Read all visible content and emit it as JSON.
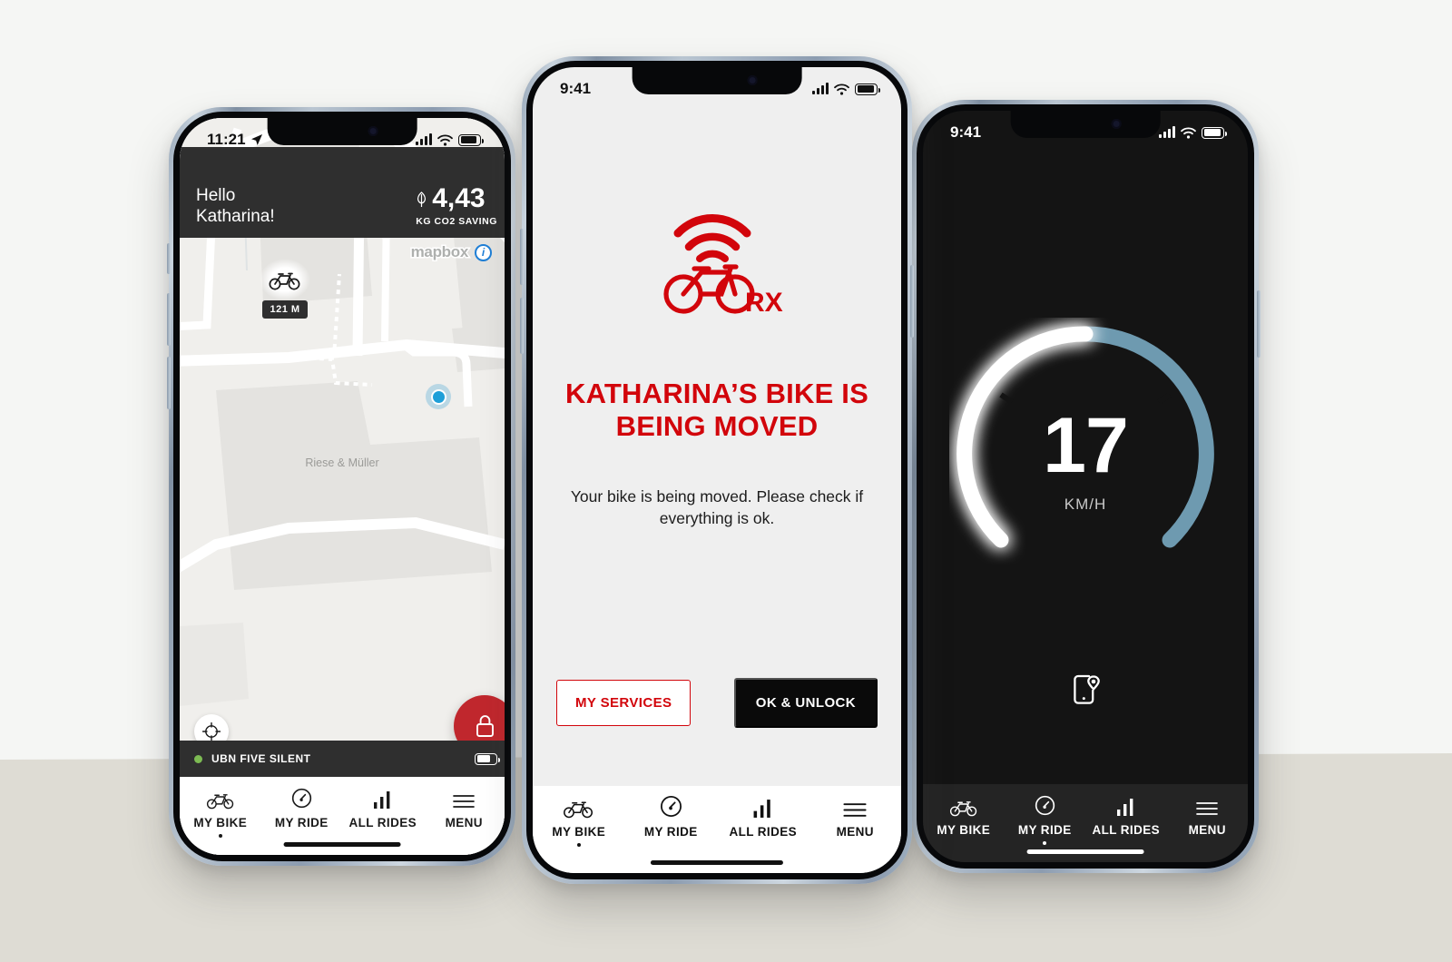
{
  "brand": {
    "red": "#d2050b",
    "lock_red": "#c0272d",
    "dark": "#2f2f2f",
    "accent_blue": "#6e9ab0"
  },
  "background": {
    "top_color": "#f5f6f4",
    "floor_color": "#dedcd4"
  },
  "phones": [
    {
      "id": "map-screen",
      "status": {
        "time": "11:21",
        "location_arrow": "location-arrow-icon"
      },
      "greeting": {
        "line1": "Hello",
        "line2": "Katharina!"
      },
      "co2": {
        "value": "4,43",
        "label": "KG CO2 SAVING",
        "icon": "leaf-icon"
      },
      "map": {
        "attribution": "mapbox",
        "info_label": "i",
        "bike_marker_distance": "121 M",
        "place_label": "Riese & Müller"
      },
      "locate_button": "crosshair-icon",
      "lock_button": "lock-icon",
      "bike_status": {
        "name": "UBN FIVE SILENT",
        "connected": true,
        "battery": "battery-icon"
      },
      "tabs": [
        {
          "label": "MY BIKE",
          "icon": "bicycle-icon",
          "active": true
        },
        {
          "label": "MY RIDE",
          "icon": "speedometer-icon",
          "active": false
        },
        {
          "label": "ALL RIDES",
          "icon": "bar-chart-icon",
          "active": false
        },
        {
          "label": "MENU",
          "icon": "hamburger-icon",
          "active": false
        }
      ]
    },
    {
      "id": "bike-moved-alert",
      "status": {
        "time": "9:41"
      },
      "logo": {
        "name": "bike-rx-logo",
        "text": "RX"
      },
      "title": "KATHARINA’S BIKE IS BEING MOVED",
      "body": "Your bike is being moved. Please check if everything is ok.",
      "buttons": {
        "secondary": "MY SERVICES",
        "primary": "OK & UNLOCK"
      },
      "tabs": [
        {
          "label": "MY BIKE",
          "icon": "bicycle-icon",
          "active": true
        },
        {
          "label": "MY RIDE",
          "icon": "speedometer-icon",
          "active": false
        },
        {
          "label": "ALL RIDES",
          "icon": "bar-chart-icon",
          "active": false
        },
        {
          "label": "MENU",
          "icon": "hamburger-icon",
          "active": false
        }
      ]
    },
    {
      "id": "ride-speed-screen",
      "status": {
        "time": "9:41"
      },
      "gauge": {
        "speed": "17",
        "unit": "KM/H",
        "progress_percent": 52
      },
      "phone_locate_icon": "phone-location-icon",
      "tabs": [
        {
          "label": "MY BIKE",
          "icon": "bicycle-icon",
          "active": false
        },
        {
          "label": "MY RIDE",
          "icon": "speedometer-icon",
          "active": true
        },
        {
          "label": "ALL RIDES",
          "icon": "bar-chart-icon",
          "active": false
        },
        {
          "label": "MENU",
          "icon": "hamburger-icon",
          "active": false
        }
      ]
    }
  ]
}
